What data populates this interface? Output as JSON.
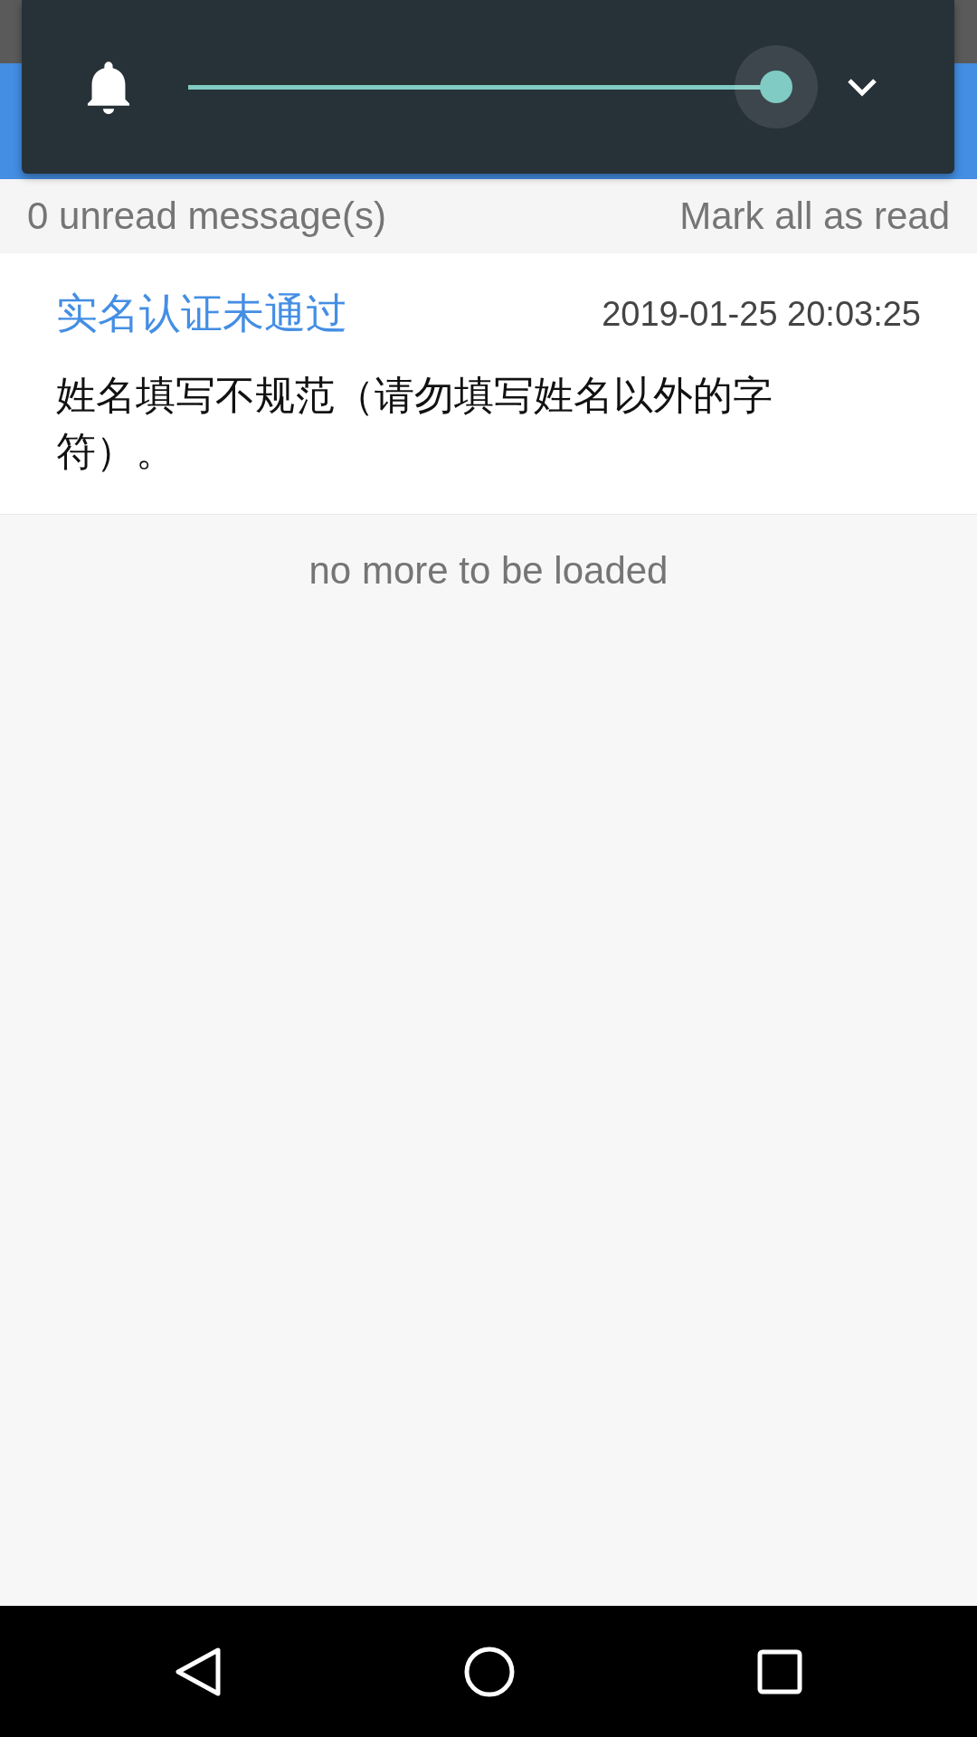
{
  "volume_panel": {
    "level": 1
  },
  "unread_bar": {
    "count": "0 unread message(s)",
    "action": "Mark all as read"
  },
  "messages": [
    {
      "title": "实名认证未通过",
      "time": "2019-01-25 20:03:25",
      "body": "姓名填写不规范（请勿填写姓名以外的字符）。"
    }
  ],
  "footer": "no more to be loaded"
}
